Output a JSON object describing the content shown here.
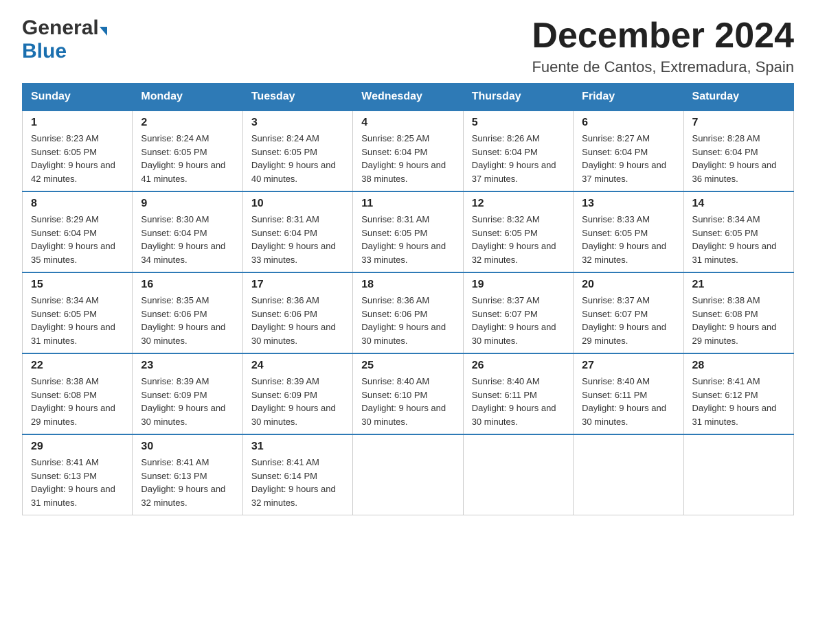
{
  "logo": {
    "general": "General",
    "blue": "Blue",
    "arrow": "▶"
  },
  "header": {
    "month_year": "December 2024",
    "location": "Fuente de Cantos, Extremadura, Spain"
  },
  "weekdays": [
    "Sunday",
    "Monday",
    "Tuesday",
    "Wednesday",
    "Thursday",
    "Friday",
    "Saturday"
  ],
  "weeks": [
    [
      {
        "day": "1",
        "sunrise": "Sunrise: 8:23 AM",
        "sunset": "Sunset: 6:05 PM",
        "daylight": "Daylight: 9 hours and 42 minutes."
      },
      {
        "day": "2",
        "sunrise": "Sunrise: 8:24 AM",
        "sunset": "Sunset: 6:05 PM",
        "daylight": "Daylight: 9 hours and 41 minutes."
      },
      {
        "day": "3",
        "sunrise": "Sunrise: 8:24 AM",
        "sunset": "Sunset: 6:05 PM",
        "daylight": "Daylight: 9 hours and 40 minutes."
      },
      {
        "day": "4",
        "sunrise": "Sunrise: 8:25 AM",
        "sunset": "Sunset: 6:04 PM",
        "daylight": "Daylight: 9 hours and 38 minutes."
      },
      {
        "day": "5",
        "sunrise": "Sunrise: 8:26 AM",
        "sunset": "Sunset: 6:04 PM",
        "daylight": "Daylight: 9 hours and 37 minutes."
      },
      {
        "day": "6",
        "sunrise": "Sunrise: 8:27 AM",
        "sunset": "Sunset: 6:04 PM",
        "daylight": "Daylight: 9 hours and 37 minutes."
      },
      {
        "day": "7",
        "sunrise": "Sunrise: 8:28 AM",
        "sunset": "Sunset: 6:04 PM",
        "daylight": "Daylight: 9 hours and 36 minutes."
      }
    ],
    [
      {
        "day": "8",
        "sunrise": "Sunrise: 8:29 AM",
        "sunset": "Sunset: 6:04 PM",
        "daylight": "Daylight: 9 hours and 35 minutes."
      },
      {
        "day": "9",
        "sunrise": "Sunrise: 8:30 AM",
        "sunset": "Sunset: 6:04 PM",
        "daylight": "Daylight: 9 hours and 34 minutes."
      },
      {
        "day": "10",
        "sunrise": "Sunrise: 8:31 AM",
        "sunset": "Sunset: 6:04 PM",
        "daylight": "Daylight: 9 hours and 33 minutes."
      },
      {
        "day": "11",
        "sunrise": "Sunrise: 8:31 AM",
        "sunset": "Sunset: 6:05 PM",
        "daylight": "Daylight: 9 hours and 33 minutes."
      },
      {
        "day": "12",
        "sunrise": "Sunrise: 8:32 AM",
        "sunset": "Sunset: 6:05 PM",
        "daylight": "Daylight: 9 hours and 32 minutes."
      },
      {
        "day": "13",
        "sunrise": "Sunrise: 8:33 AM",
        "sunset": "Sunset: 6:05 PM",
        "daylight": "Daylight: 9 hours and 32 minutes."
      },
      {
        "day": "14",
        "sunrise": "Sunrise: 8:34 AM",
        "sunset": "Sunset: 6:05 PM",
        "daylight": "Daylight: 9 hours and 31 minutes."
      }
    ],
    [
      {
        "day": "15",
        "sunrise": "Sunrise: 8:34 AM",
        "sunset": "Sunset: 6:05 PM",
        "daylight": "Daylight: 9 hours and 31 minutes."
      },
      {
        "day": "16",
        "sunrise": "Sunrise: 8:35 AM",
        "sunset": "Sunset: 6:06 PM",
        "daylight": "Daylight: 9 hours and 30 minutes."
      },
      {
        "day": "17",
        "sunrise": "Sunrise: 8:36 AM",
        "sunset": "Sunset: 6:06 PM",
        "daylight": "Daylight: 9 hours and 30 minutes."
      },
      {
        "day": "18",
        "sunrise": "Sunrise: 8:36 AM",
        "sunset": "Sunset: 6:06 PM",
        "daylight": "Daylight: 9 hours and 30 minutes."
      },
      {
        "day": "19",
        "sunrise": "Sunrise: 8:37 AM",
        "sunset": "Sunset: 6:07 PM",
        "daylight": "Daylight: 9 hours and 30 minutes."
      },
      {
        "day": "20",
        "sunrise": "Sunrise: 8:37 AM",
        "sunset": "Sunset: 6:07 PM",
        "daylight": "Daylight: 9 hours and 29 minutes."
      },
      {
        "day": "21",
        "sunrise": "Sunrise: 8:38 AM",
        "sunset": "Sunset: 6:08 PM",
        "daylight": "Daylight: 9 hours and 29 minutes."
      }
    ],
    [
      {
        "day": "22",
        "sunrise": "Sunrise: 8:38 AM",
        "sunset": "Sunset: 6:08 PM",
        "daylight": "Daylight: 9 hours and 29 minutes."
      },
      {
        "day": "23",
        "sunrise": "Sunrise: 8:39 AM",
        "sunset": "Sunset: 6:09 PM",
        "daylight": "Daylight: 9 hours and 30 minutes."
      },
      {
        "day": "24",
        "sunrise": "Sunrise: 8:39 AM",
        "sunset": "Sunset: 6:09 PM",
        "daylight": "Daylight: 9 hours and 30 minutes."
      },
      {
        "day": "25",
        "sunrise": "Sunrise: 8:40 AM",
        "sunset": "Sunset: 6:10 PM",
        "daylight": "Daylight: 9 hours and 30 minutes."
      },
      {
        "day": "26",
        "sunrise": "Sunrise: 8:40 AM",
        "sunset": "Sunset: 6:11 PM",
        "daylight": "Daylight: 9 hours and 30 minutes."
      },
      {
        "day": "27",
        "sunrise": "Sunrise: 8:40 AM",
        "sunset": "Sunset: 6:11 PM",
        "daylight": "Daylight: 9 hours and 30 minutes."
      },
      {
        "day": "28",
        "sunrise": "Sunrise: 8:41 AM",
        "sunset": "Sunset: 6:12 PM",
        "daylight": "Daylight: 9 hours and 31 minutes."
      }
    ],
    [
      {
        "day": "29",
        "sunrise": "Sunrise: 8:41 AM",
        "sunset": "Sunset: 6:13 PM",
        "daylight": "Daylight: 9 hours and 31 minutes."
      },
      {
        "day": "30",
        "sunrise": "Sunrise: 8:41 AM",
        "sunset": "Sunset: 6:13 PM",
        "daylight": "Daylight: 9 hours and 32 minutes."
      },
      {
        "day": "31",
        "sunrise": "Sunrise: 8:41 AM",
        "sunset": "Sunset: 6:14 PM",
        "daylight": "Daylight: 9 hours and 32 minutes."
      },
      null,
      null,
      null,
      null
    ]
  ]
}
